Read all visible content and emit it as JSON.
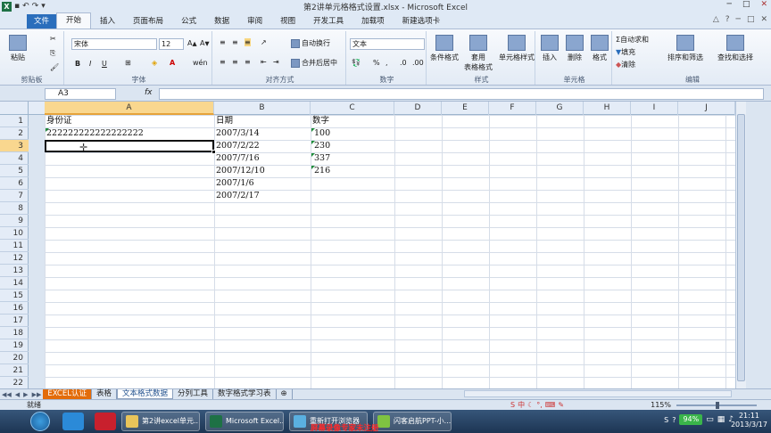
{
  "window": {
    "title": "第2讲单元格格式设置.xlsx - Microsoft Excel",
    "controls": [
      "─",
      "□",
      "✕"
    ]
  },
  "ribbon_tabs": [
    "文件",
    "开始",
    "插入",
    "页面布局",
    "公式",
    "数据",
    "审阅",
    "视图",
    "开发工具",
    "加载项",
    "新建选项卡"
  ],
  "clipboard": {
    "paste": "粘贴",
    "label": "剪贴板"
  },
  "font": {
    "name": "宋体",
    "size": "12",
    "label": "字体",
    "bold": "B",
    "italic": "I",
    "underline": "U"
  },
  "align": {
    "wrap": "自动换行",
    "merge": "合并后居中",
    "label": "对齐方式"
  },
  "number": {
    "format": "文本",
    "percent": "%",
    "comma": ",",
    "label": "数字"
  },
  "styles": {
    "cond": "条件格式",
    "table": "套用\n表格格式",
    "cell": "单元格样式",
    "label": "样式"
  },
  "cells": {
    "insert": "插入",
    "delete": "删除",
    "format": "格式",
    "label": "单元格"
  },
  "editing": {
    "autosum": "自动求和",
    "fill": "填充",
    "clear": "清除",
    "sort": "排序和筛选",
    "find": "查找和选择",
    "label": "编辑"
  },
  "formula_bar": {
    "name_box": "A3",
    "fx": "fx",
    "value": ""
  },
  "columns": [
    "A",
    "B",
    "C",
    "D",
    "E",
    "F",
    "G",
    "H",
    "I",
    "J"
  ],
  "rows": [
    "1",
    "2",
    "3",
    "4",
    "5",
    "6",
    "7",
    "8",
    "9",
    "10",
    "11",
    "12",
    "13",
    "14",
    "15",
    "16",
    "17",
    "18",
    "19",
    "20",
    "21",
    "22"
  ],
  "sheet": {
    "A1": "身份证",
    "A2": "222222222222222222",
    "B1": "日期",
    "B2": "2007/3/14",
    "B3": "2007/2/22",
    "B4": "2007/7/16",
    "B5": "2007/12/10",
    "B6": "2007/1/6",
    "B7": "2007/2/17",
    "C1": "数字",
    "C2": "100",
    "C3": "230",
    "C4": "337",
    "C5": "216"
  },
  "sheet_tabs": [
    "EXCEL认证",
    "表格",
    "文本格式数据",
    "分列工具",
    "数字格式学习表"
  ],
  "status": {
    "ready": "就绪",
    "zoom": "115%"
  },
  "taskbar": {
    "items": [
      "第2讲excel单元...",
      "Microsoft Excel...",
      "重新打开浏览器",
      "闪客启航PPT-小..."
    ],
    "watermark": "屏幕录像专家未注册",
    "battery": "94%",
    "time": "21:11",
    "date": "2013/3/17"
  }
}
